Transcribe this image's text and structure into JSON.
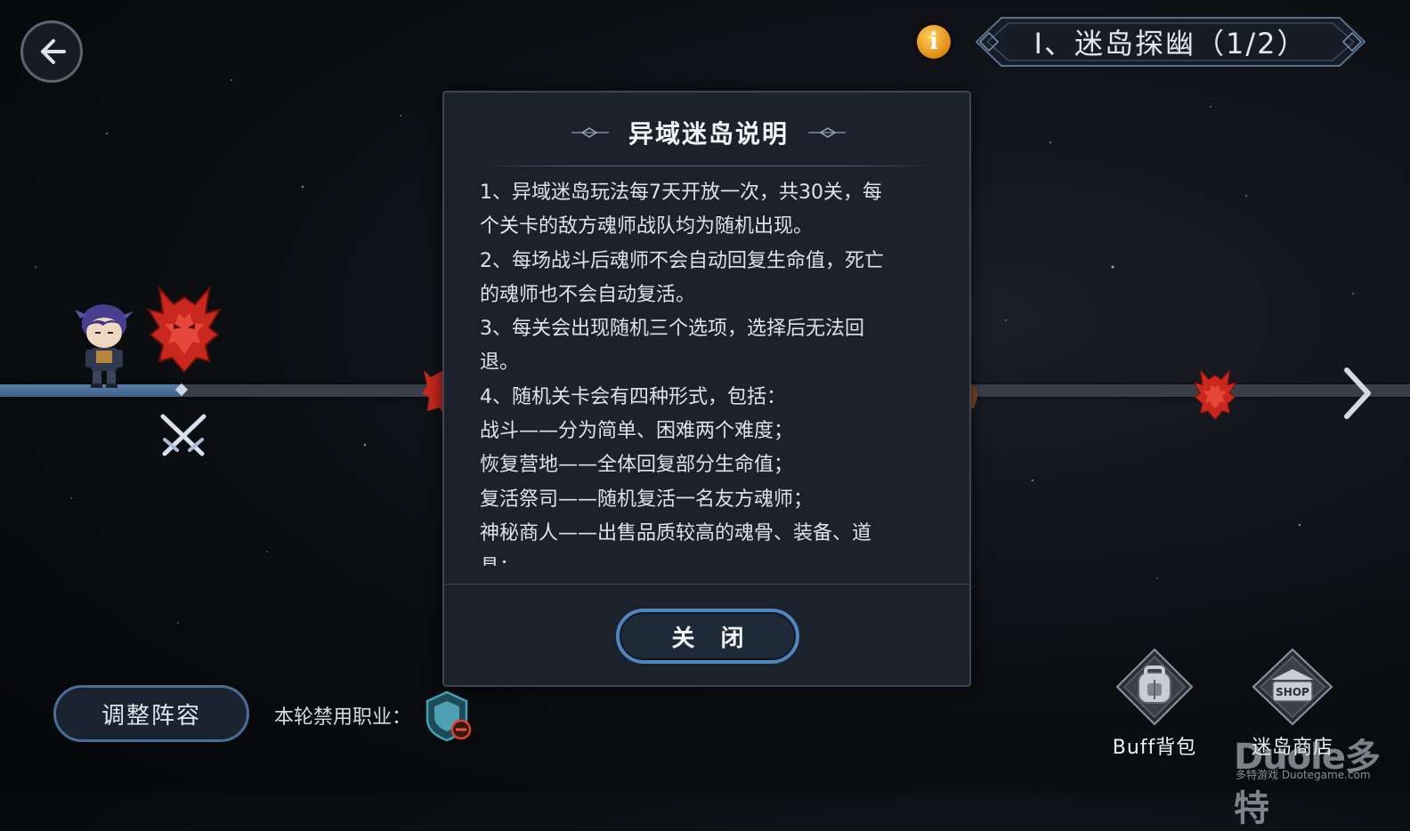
{
  "top_bar": {
    "stage_title": "Ⅰ、迷岛探幽（1/2）",
    "info_icon_glyph": "i"
  },
  "modal": {
    "title": "异域迷岛说明",
    "lines": [
      "1、异域迷岛玩法每7天开放一次，共30关，每",
      "个关卡的敌方魂师战队均为随机出现。",
      "2、每场战斗后魂师不会自动回复生命值，死亡",
      "的魂师也不会自动复活。",
      "3、每关会出现随机三个选项，选择后无法回",
      "退。",
      "4、随机关卡会有四种形式，包括：",
      "战斗——分为简单、困难两个难度；",
      "恢复营地——全体回复部分生命值；",
      "复活祭司——随机复活一名友方魂师；",
      "神秘商人——出售品质较高的魂骨、装备、道",
      "具；"
    ],
    "close_label": "关 闭"
  },
  "bottom": {
    "adjust_label": "调整阵容",
    "ban_label": "本轮禁用职业：",
    "bag_label": "Buff背包",
    "shop_label": "迷岛商店",
    "shop_sign": "SHOP"
  },
  "watermark": {
    "brand": "Duole多特",
    "sub": "多特游戏 Duotegame.com"
  },
  "colors": {
    "accent_blue": "#4f86c0",
    "enemy_red": "#c9281e",
    "info_orange": "#e08a15",
    "modal_bg": "#1c222b"
  },
  "icons": [
    "back-arrow-icon",
    "info-icon",
    "enemy-emblem-icon",
    "crossed-swords-icon",
    "next-arrow-icon",
    "ban-class-icon",
    "buff-bag-icon",
    "shop-icon"
  ]
}
